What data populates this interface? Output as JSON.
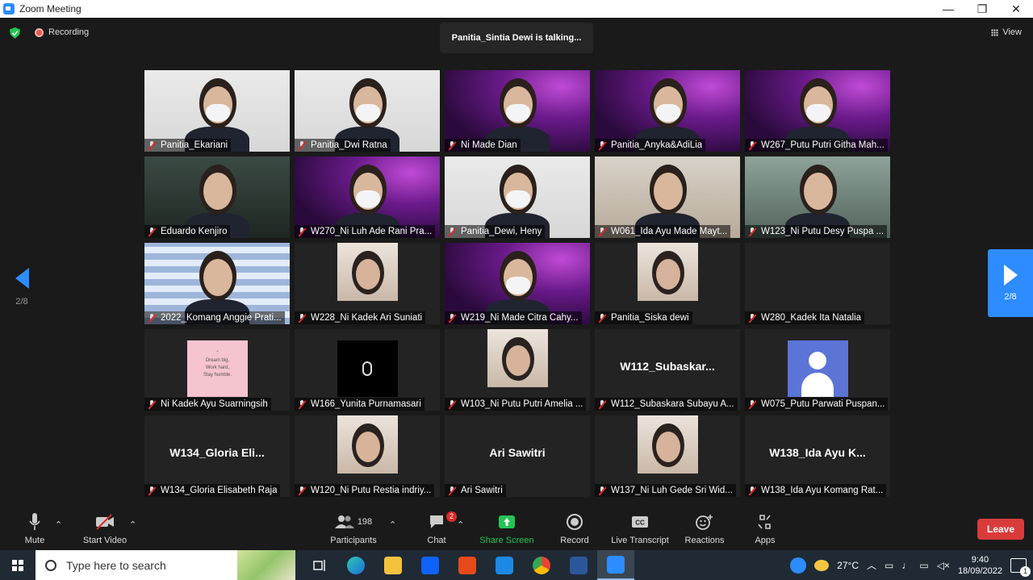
{
  "window": {
    "title": "Zoom Meeting",
    "controls": [
      "—",
      "❐",
      "✕"
    ]
  },
  "meeting": {
    "recording_label": "Recording",
    "talking_banner": "Panitia_Sintia Dewi is talking...",
    "view_label": "View",
    "page_left": "2/8",
    "page_right": "2/8"
  },
  "participants": [
    {
      "name": "Panitia_Ekariani",
      "scene": "white"
    },
    {
      "name": "Panitia_Dwi Ratna",
      "scene": "white"
    },
    {
      "name": "Ni Made Dian",
      "scene": "purple"
    },
    {
      "name": "Panitia_Anyka&AdiLia",
      "scene": "purple"
    },
    {
      "name": "W267_Putu Putri Githa Mah...",
      "scene": "purple"
    },
    {
      "name": "Eduardo Kenjiro",
      "scene": "dark"
    },
    {
      "name": "W270_Ni Luh Ade Rani Pra...",
      "scene": "purple"
    },
    {
      "name": "Panitia_Dewi, Heny",
      "scene": "white"
    },
    {
      "name": "W061_Ida Ayu Made Mayt...",
      "scene": "room"
    },
    {
      "name": "W123_Ni Putu Desy Puspa ...",
      "scene": "green"
    },
    {
      "name": "2022_Komang Anggie Prati...",
      "scene": "check"
    },
    {
      "name": "W228_Ni Kadek Ari Suniati",
      "scene": "small"
    },
    {
      "name": "W219_Ni Made Citra Cahy...",
      "scene": "purple"
    },
    {
      "name": "Panitia_Siska dewi",
      "scene": "small"
    },
    {
      "name": "W280_Kadek Ita Natalia",
      "scene": "none"
    },
    {
      "name": "Ni Kadek Ayu Suarningsih",
      "scene": "quote",
      "quote": "“\nDream big,\nWork hard,\nStay humble."
    },
    {
      "name": "W166_Yunita Purnamasari",
      "scene": "black"
    },
    {
      "name": "W103_Ni Putu Putri Amelia ...",
      "scene": "small"
    },
    {
      "name": "W112_Subaskara Subayu A...",
      "scene": "text",
      "big": "W112_Subaskar..."
    },
    {
      "name": "W075_Putu Parwati Puspan...",
      "scene": "avatar"
    },
    {
      "name": "W134_Gloria Elisabeth Raja",
      "scene": "text",
      "big": "W134_Gloria  Eli..."
    },
    {
      "name": "W120_Ni Putu Restia indriy...",
      "scene": "small"
    },
    {
      "name": "Ari Sawitri",
      "scene": "text",
      "big": "Ari Sawitri"
    },
    {
      "name": "W137_Ni Luh Gede Sri Wid...",
      "scene": "small"
    },
    {
      "name": "W138_Ida Ayu Komang Rat...",
      "scene": "text",
      "big": "W138_Ida Ayu K..."
    }
  ],
  "toolbar": {
    "mute": "Mute",
    "start_video": "Start Video",
    "participants_count": "198",
    "participants": "Participants",
    "chat": "Chat",
    "chat_badge": "2",
    "share_screen": "Share Screen",
    "record": "Record",
    "live_transcript": "Live Transcript",
    "reactions": "Reactions",
    "apps": "Apps",
    "leave": "Leave"
  },
  "taskbar": {
    "search_placeholder": "Type here to search",
    "temperature": "27°C",
    "time": "9:40",
    "date": "18/09/2022",
    "notification_count": "1"
  },
  "colors": {
    "zoom_blue": "#2d8cff",
    "leave_red": "#d93b3b",
    "share_green": "#23c552",
    "background": "#1a1a1a"
  }
}
